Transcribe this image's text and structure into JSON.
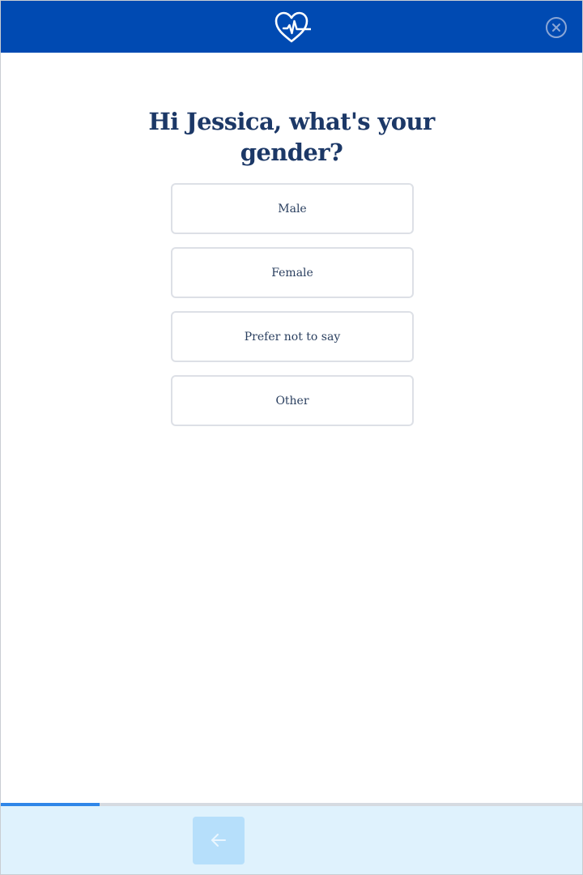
{
  "header": {
    "logo_icon": "heart-pulse-icon",
    "close_icon": "close-circle-icon",
    "background_color": "#004ab2"
  },
  "question": {
    "title": "Hi Jessica, what's your gender?"
  },
  "options": [
    {
      "label": "Male"
    },
    {
      "label": "Female"
    },
    {
      "label": "Prefer not to say"
    },
    {
      "label": "Other"
    }
  ],
  "progress": {
    "fraction": 0.17,
    "fill_color": "#2f86e8"
  },
  "footer": {
    "back_icon": "arrow-left-icon",
    "background_color": "#dff2fd"
  }
}
